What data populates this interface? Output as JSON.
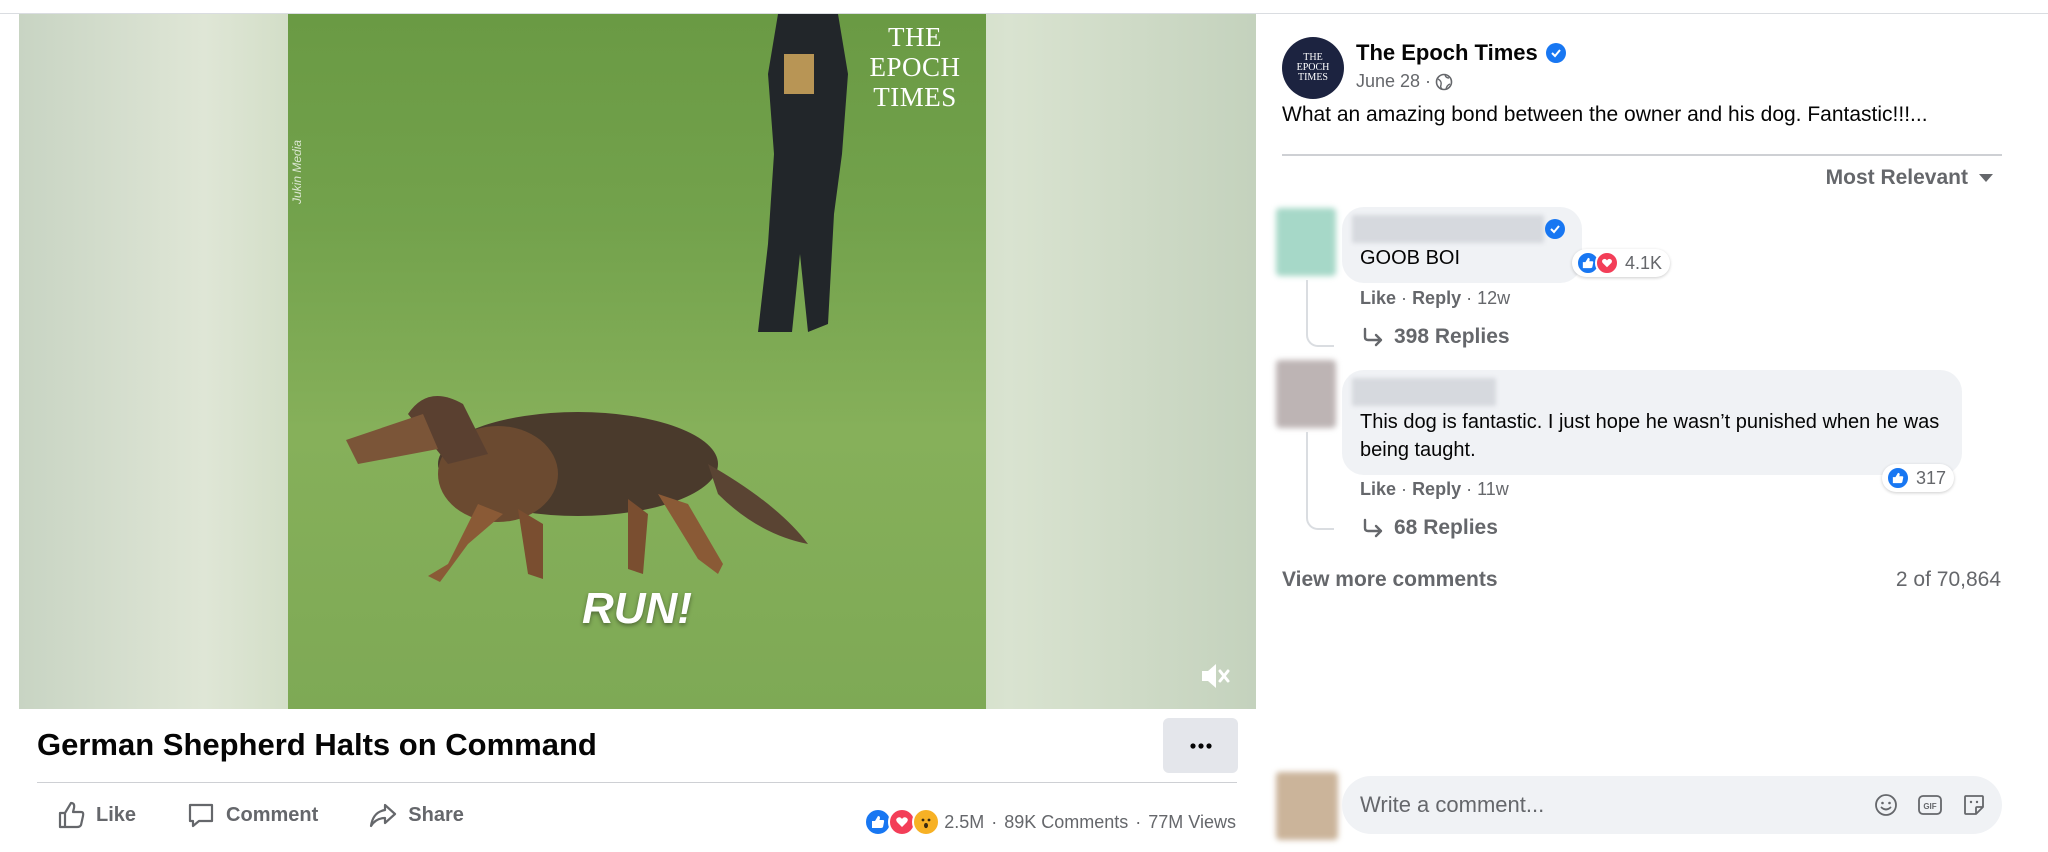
{
  "video": {
    "watermark_line1": "THE",
    "watermark_line2": "EPOCH",
    "watermark_line3": "TIMES",
    "credit": "Jukin Media",
    "overlay_text": "RUN!",
    "title": "German Shepherd Halts on Command"
  },
  "actions": {
    "like": "Like",
    "comment": "Comment",
    "share": "Share"
  },
  "stats": {
    "reactions": "2.5M",
    "comments": "89K Comments",
    "views": "77M Views",
    "dot": "·"
  },
  "post": {
    "page_name": "The Epoch Times",
    "avatar_text_1": "THE",
    "avatar_text_2": "EPOCH",
    "avatar_text_3": "TIMES",
    "date": "June 28 ·",
    "caption": "What an amazing bond between the owner and his dog. Fantastic!!!..."
  },
  "sort_label": "Most Relevant",
  "comments": [
    {
      "text": "GOOB BOI",
      "reactions": "4.1K",
      "like": "Like",
      "reply": "Reply",
      "time": "12w",
      "replies": "398 Replies",
      "sep": "·"
    },
    {
      "text": "This dog is fantastic. I just hope he wasn’t punished when he was being taught.",
      "reactions": "317",
      "like": "Like",
      "reply": "Reply",
      "time": "11w",
      "replies": "68 Replies",
      "sep": "·"
    }
  ],
  "view_more": "View more comments",
  "count": "2 of 70,864",
  "composer": {
    "placeholder": "Write a comment..."
  },
  "icons": {
    "like": "thumbs-up-icon",
    "comment": "speech-bubble-icon",
    "share": "share-arrow-icon",
    "mute": "speaker-muted-icon",
    "more": "more-dots-icon",
    "globe": "globe-icon",
    "verified": "verified-badge-icon",
    "sort": "caret-down-icon",
    "reply_arrow": "reply-arrow-icon",
    "emoji": "emoji-icon",
    "gif": "gif-icon",
    "sticker": "sticker-icon"
  },
  "colors": {
    "accent": "#1877f2",
    "love": "#f33e58",
    "wow": "#f7b125",
    "muted_text": "#65676b",
    "bubble": "#f0f2f5"
  }
}
